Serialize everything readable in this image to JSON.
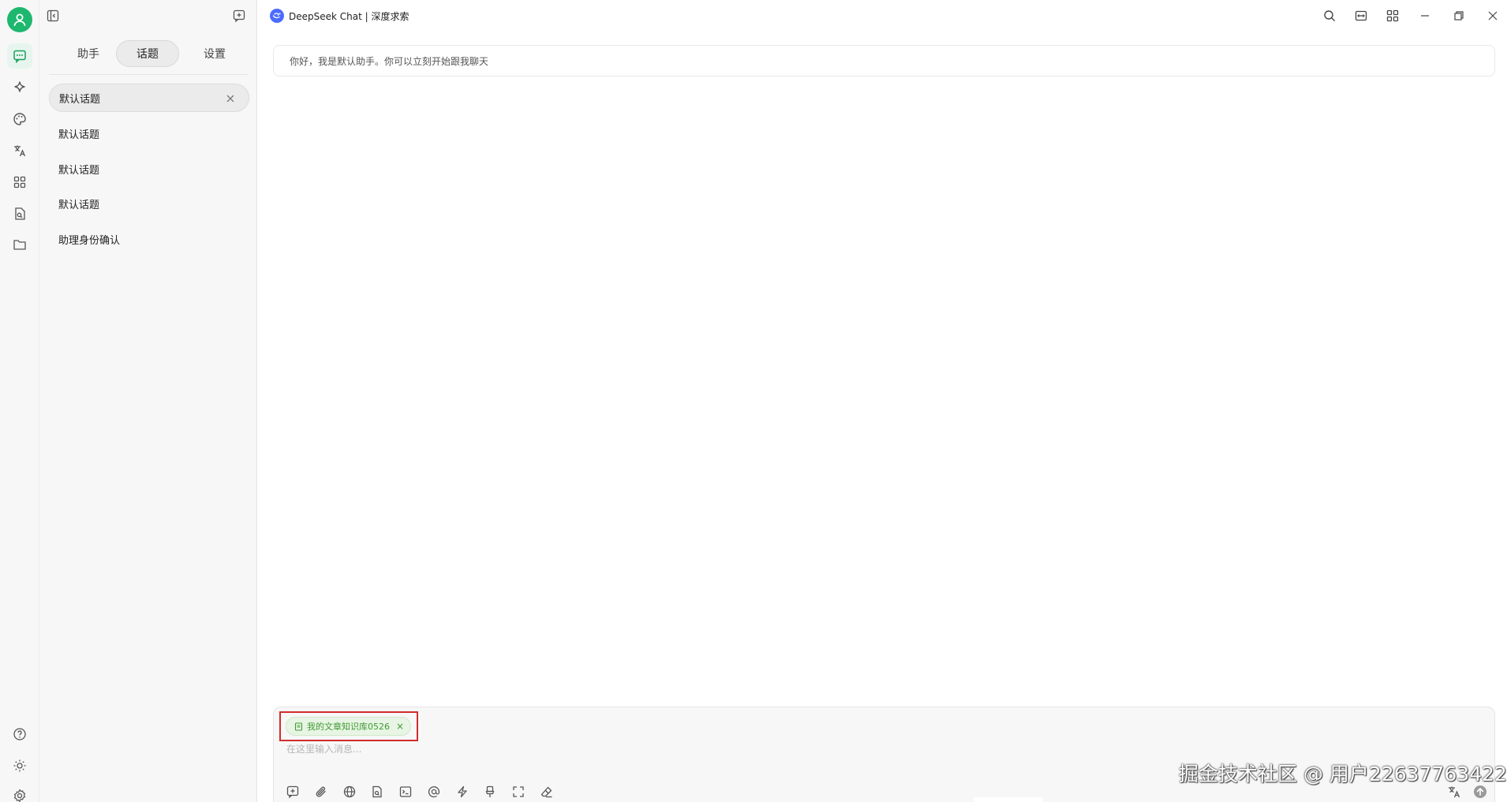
{
  "window": {
    "title": "DeepSeek Chat | 深度求索"
  },
  "rail": {
    "icons": [
      "user-avatar-icon",
      "chat-icon",
      "sparkle-icon",
      "palette-icon",
      "translate-icon",
      "apps-grid-icon",
      "file-search-icon",
      "folder-icon",
      "help-icon",
      "brightness-icon",
      "settings-gear-icon"
    ]
  },
  "panel": {
    "tabs": [
      {
        "label": "助手"
      },
      {
        "label": "话题"
      },
      {
        "label": "设置"
      }
    ],
    "active_tab": "话题",
    "topics": [
      {
        "label": "默认话题"
      },
      {
        "label": "默认话题"
      },
      {
        "label": "默认话题"
      },
      {
        "label": "默认话题"
      },
      {
        "label": "助理身份确认"
      }
    ]
  },
  "main": {
    "greeting": "你好，我是默认助手。你可以立刻开始跟我聊天"
  },
  "composer": {
    "knowledge_tag": "我的文章知识库0526",
    "placeholder": "在这里输入消息...",
    "tools": [
      "new-topic-icon",
      "attachment-icon",
      "web-search-icon",
      "knowledge-base-icon",
      "terminal-icon",
      "mention-icon",
      "quick-phrase-icon",
      "pin-icon",
      "expand-icon",
      "eraser-icon",
      "translate-icon",
      "send-icon"
    ]
  },
  "watermark": {
    "text": "掘金技术社区 @ 用户22637763422"
  },
  "colors": {
    "accent_green": "#1db76e",
    "tag_green": "#3f9a31",
    "highlight_red": "#d02c2c",
    "deepseek_blue": "#4d6bfe"
  }
}
